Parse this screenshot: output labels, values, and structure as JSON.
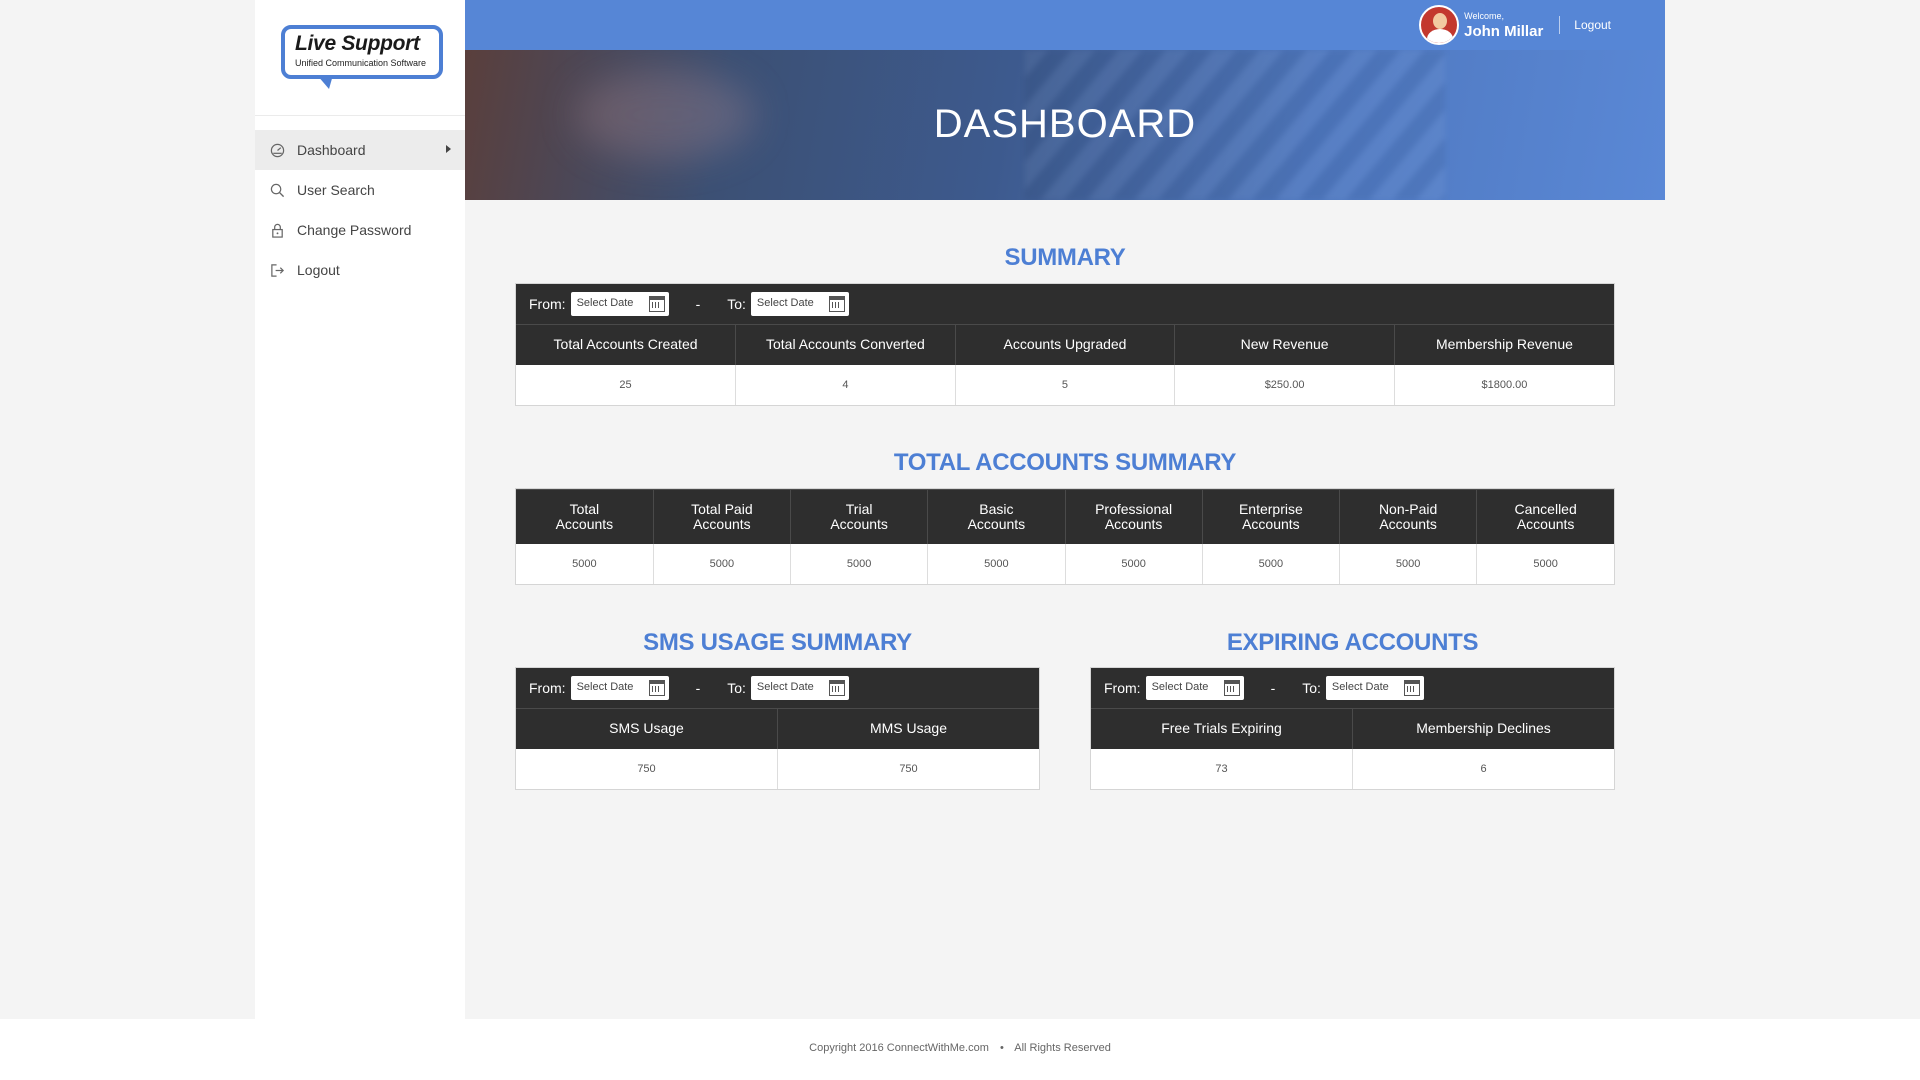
{
  "brand": {
    "title": "Live Support",
    "subtitle": "Unified Communication Software"
  },
  "sidebar": {
    "items": [
      {
        "label": "Dashboard",
        "icon": "dashboard-icon",
        "active": true
      },
      {
        "label": "User Search",
        "icon": "search-icon"
      },
      {
        "label": "Change Password",
        "icon": "lock-icon"
      },
      {
        "label": "Logout",
        "icon": "logout-icon"
      }
    ]
  },
  "header": {
    "welcome": "Welcome,",
    "user_name": "John Millar",
    "logout": "Logout"
  },
  "hero": {
    "title": "DASHBOARD"
  },
  "colors": {
    "accent": "#5686d6",
    "title_blue": "#4d7fd4",
    "header_dark": "#2e2e2e"
  },
  "summary": {
    "title": "SUMMARY",
    "from_label": "From:",
    "to_label": "To:",
    "separator": "-",
    "from_placeholder": "Select Date",
    "to_placeholder": "Select Date",
    "columns": [
      "Total Accounts Created",
      "Total Accounts Converted",
      "Accounts Upgraded",
      "New Revenue",
      "Membership Revenue"
    ],
    "values": [
      "25",
      "4",
      "5",
      "$250.00",
      "$1800.00"
    ]
  },
  "total_accounts": {
    "title": "TOTAL ACCOUNTS SUMMARY",
    "columns": [
      [
        "Total",
        "Accounts"
      ],
      [
        "Total Paid",
        "Accounts"
      ],
      [
        "Trial",
        "Accounts"
      ],
      [
        "Basic",
        "Accounts"
      ],
      [
        "Professional",
        "Accounts"
      ],
      [
        "Enterprise",
        "Accounts"
      ],
      [
        "Non-Paid",
        "Accounts"
      ],
      [
        "Cancelled",
        "Accounts"
      ]
    ],
    "values": [
      "5000",
      "5000",
      "5000",
      "5000",
      "5000",
      "5000",
      "5000",
      "5000"
    ]
  },
  "sms": {
    "title": "SMS USAGE SUMMARY",
    "from_label": "From:",
    "to_label": "To:",
    "separator": "-",
    "from_placeholder": "Select Date",
    "to_placeholder": "Select Date",
    "columns": [
      "SMS Usage",
      "MMS Usage"
    ],
    "values": [
      "750",
      "750"
    ]
  },
  "expiring": {
    "title": "EXPIRING ACCOUNTS",
    "from_label": "From:",
    "to_label": "To:",
    "separator": "-",
    "from_placeholder": "Select Date",
    "to_placeholder": "Select Date",
    "columns": [
      "Free Trials Expiring",
      "Membership Declines"
    ],
    "values": [
      "73",
      "6"
    ]
  },
  "footer": {
    "copyright": "Copyright 2016 ConnectWithMe.com",
    "rights": "All Rights Reserved"
  }
}
